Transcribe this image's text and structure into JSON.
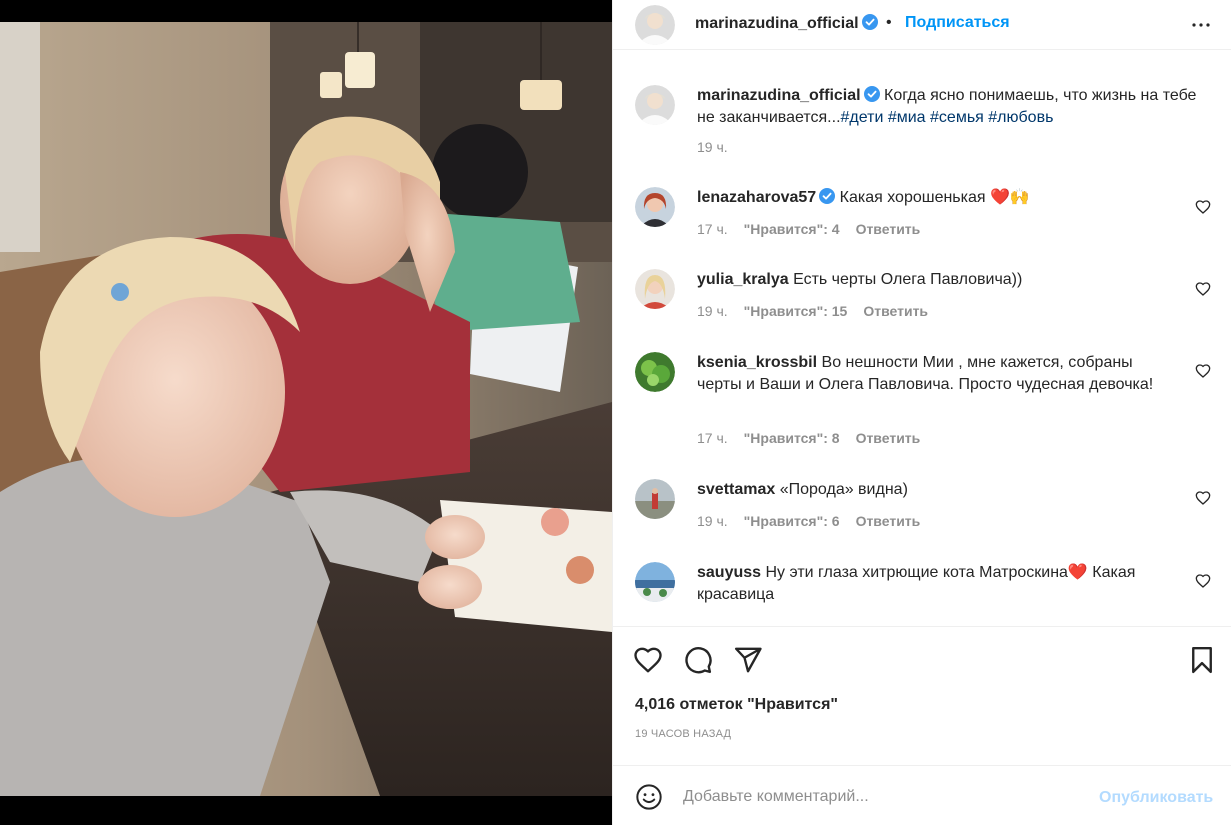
{
  "post": {
    "author": "marinazudina_official",
    "follow_label": "Подписаться",
    "separator": "•",
    "caption": {
      "username": "marinazudina_official",
      "text": "Когда ясно понимаешь, что жизнь на тебе не заканчивается...",
      "hashtags": [
        "#дети",
        "#миа",
        "#семья",
        "#любовь"
      ],
      "age": "19 ч."
    },
    "comments": [
      {
        "username": "lenazaharova57",
        "verified": true,
        "text": "Какая хорошенькая ❤️🙌",
        "age": "17 ч.",
        "likes": "\"Нравится\": 4",
        "reply": "Ответить"
      },
      {
        "username": "yulia_kralya",
        "verified": false,
        "text": "Есть черты Олега Павловича))",
        "age": "19 ч.",
        "likes": "\"Нравится\": 15",
        "reply": "Ответить"
      },
      {
        "username": "ksenia_krossbil",
        "verified": false,
        "text": "Во нешности Мии , мне кажется, собраны черты и Ваши и Олега Павловича. Просто чудесная девочка!",
        "age": "17 ч.",
        "likes": "\"Нравится\": 8",
        "reply": "Ответить"
      },
      {
        "username": "svettamax",
        "verified": false,
        "text": "«Порода» видна)",
        "age": "19 ч.",
        "likes": "\"Нравится\": 6",
        "reply": "Ответить"
      },
      {
        "username": "sauyuss",
        "verified": false,
        "text": "Ну эти глаза хитрющие кота Матроскина❤️ Какая красавица",
        "age": "",
        "likes": "",
        "reply": ""
      }
    ],
    "likes_count": "4,016 отметок \"Нравится\"",
    "timestamp": "19 ЧАСОВ НАЗАД",
    "composer": {
      "placeholder": "Добавьте комментарий...",
      "publish_label": "Опубликовать"
    }
  },
  "icons": {
    "verified": "verified-badge-icon",
    "more": "more-horizontal-icon",
    "like": "heart-icon",
    "comment": "comment-bubble-icon",
    "share": "paper-plane-icon",
    "save": "bookmark-icon",
    "emoji": "smiley-icon"
  },
  "colors": {
    "accent": "#0095f6",
    "publish_disabled": "#b3dbff",
    "verified": "#3897f0",
    "hashtag": "#00376b",
    "muted": "#8e8e8e"
  }
}
